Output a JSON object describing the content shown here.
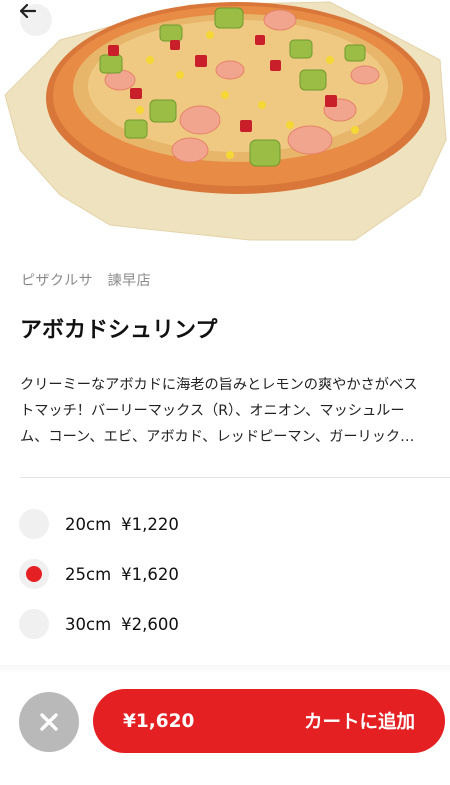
{
  "header": {
    "back_icon": "arrow-left-icon"
  },
  "product": {
    "image_icon": "pizza-image",
    "shop": "ピザクルサ　諫早店",
    "title": "アボカドシュリンプ",
    "description": "クリーミーなアボカドに海老の旨みとレモンの爽やかさがベストマッチ！バーリーマックス（R）、オニオン、マッシュルーム、コーン、エビ、アボカド、レッドピーマン、ガーリック…"
  },
  "sizes": [
    {
      "size": "20cm",
      "price": "¥1,220",
      "selected": false
    },
    {
      "size": "25cm",
      "price": "¥1,620",
      "selected": true
    },
    {
      "size": "30cm",
      "price": "¥2,600",
      "selected": false
    }
  ],
  "footer": {
    "close_icon": "close-icon",
    "cart_price": "¥1,620",
    "cart_label": "カートに追加"
  },
  "colors": {
    "accent": "#e52022",
    "close_bg": "#b9b9b9",
    "radio_bg": "#f0f0f0",
    "muted_text": "#8a8a8a"
  }
}
